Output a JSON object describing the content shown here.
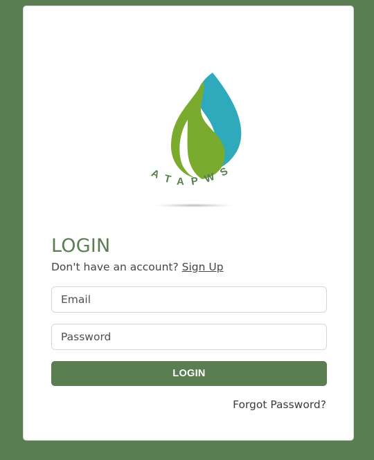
{
  "logo": {
    "wordmark": "ATAPWS",
    "colors": {
      "green": "#7aab2f",
      "teal": "#2fa9bc",
      "text": "#5a7d52"
    }
  },
  "login": {
    "heading": "LOGIN",
    "signup_prompt": "Don't have an account?",
    "signup_link": "Sign Up",
    "email_placeholder": "Email",
    "password_placeholder": "Password",
    "submit_label": "LOGIN",
    "forgot_link": "Forgot Password?"
  },
  "theme": {
    "background": "#5a7d52",
    "accent": "#5a7d52"
  }
}
